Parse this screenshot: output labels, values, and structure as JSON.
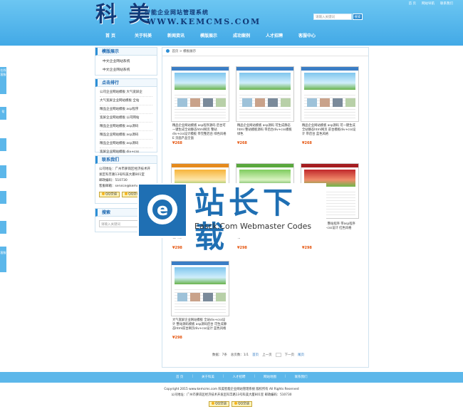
{
  "header": {
    "logo_big": "科 美",
    "logo_sub": "智能企业网站管理系统",
    "logo_url": "WWW.KEMCMS.COM",
    "top_links": [
      "首 页",
      "网站导航",
      "联系我们"
    ],
    "search_placeholder": "请输入关键词",
    "search_btn": "搜索"
  },
  "nav": [
    "首 页",
    "关于科美",
    "新闻资讯",
    "模版展示",
    "成功案例",
    "人才招聘",
    "客服中心"
  ],
  "side_tabs": [
    "在线客服",
    "帮",
    "",
    "",
    "",
    "",
    "",
    "客服"
  ],
  "sidebar": {
    "cat_title": "模版展示",
    "cat_items": [
      "中文企业网站系统",
      "中文企业网站系统"
    ],
    "rank_title": "点击排行",
    "rank_items": [
      "公司企业网站模板 大气宽屏企",
      "大气宽屏企业网站模板 全站",
      "精品企业网站模板 asp程序",
      "宽屏企业网站模板 公司网站",
      "精品企业网站模板 asp源码",
      "精品企业网站模板 asp源码",
      "精品企业网站模板 asp源码",
      "宽屏企业网站模板 div+css"
    ],
    "contact_title": "联系我们",
    "contact_lines": [
      "公司地址：广州市萝岗区经济技术开",
      "发区科丰路13号科美大厦801室",
      "邮政编码：510730",
      "客服邮箱：service@kemcms"
    ],
    "qq_labels": [
      "QQ交谈",
      "QQ交谈"
    ],
    "search_title": "搜索",
    "search_placeholder": "请输入关键词"
  },
  "main": {
    "crumb": [
      "首页",
      "模板展示"
    ],
    "products": [
      {
        "title": "精品企业网站模板 asp程序源码 后台可一键生成全站静态html网页 整站div+css设计模板 带完整后台 绿色风格 E 页面产品全面",
        "price": "¥268"
      },
      {
        "title": "精品企业网站模板 asp源码 可生成静态html 整站模板源码 带后台div+css模板 绿色",
        "price": "¥268"
      },
      {
        "title": "精品企业网站模板 asp源码 可一键生成全站静态html网页 前台模板div+css设计 带后台 蓝色风格",
        "price": "¥268"
      },
      {
        "title": "色风格",
        "price": "¥298"
      },
      {
        "title": "格",
        "price": "¥298"
      },
      {
        "title": "公司企业网站模板 整站程序 带asp程序后台 css前台div+css设计 红色风格",
        "price": "¥298"
      },
      {
        "title": "大气宽屏企业网站模板 全站div+css设计 整站源码模板 asp源码后台 可生成静态html前台网页div+css设计 蓝色风格",
        "price": "¥298"
      }
    ],
    "pager": {
      "total": "数据：7条",
      "pages": "总页数：1/1",
      "first": "首页",
      "prev": "上一页",
      "next": "下一页",
      "last": "尾页"
    }
  },
  "watermark": {
    "cn": "站长下载",
    "en": "Easck.Com Webmaster Codes"
  },
  "footer": {
    "links": [
      "首 页",
      "关于科美",
      "人才招聘",
      "网站地图",
      "联系我们"
    ],
    "copyright": "Copyright 2015 www.kemcms.com 科美智能企业网站管理系统 版权所有 All Rights Reserved",
    "address": "公司地址：广州市萝岗区经济技术开发区科丰路13号科美大厦801室 邮政编码：510730",
    "qq_labels": [
      "QQ交谈",
      "QQ交谈"
    ]
  }
}
